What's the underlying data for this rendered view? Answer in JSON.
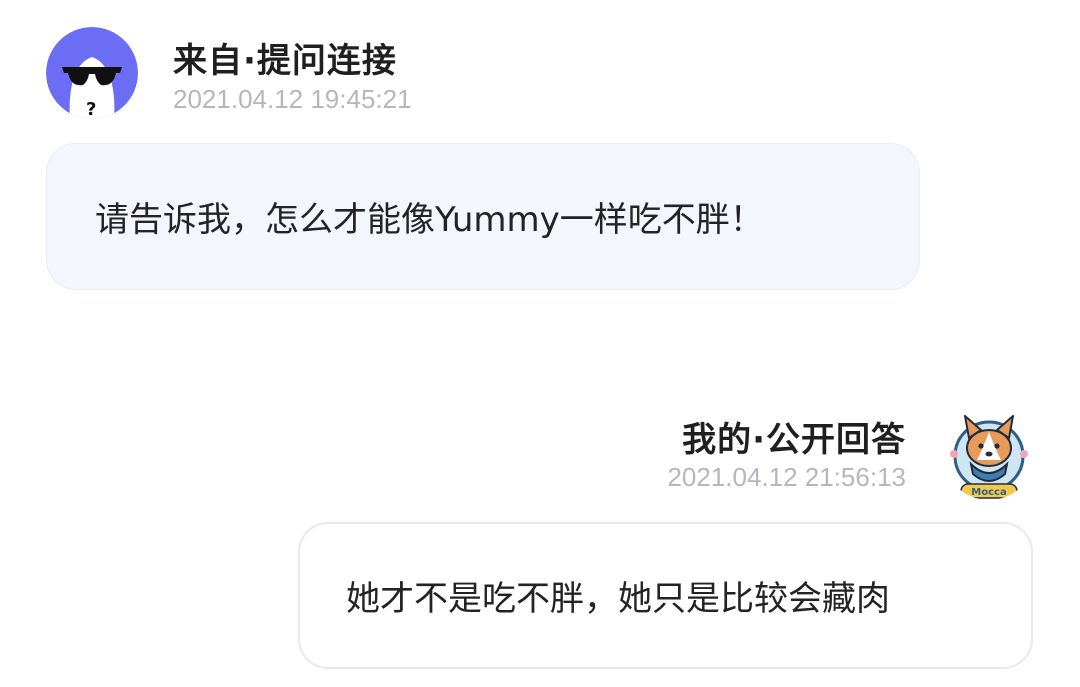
{
  "question": {
    "sender": "来自·提问连接",
    "timestamp": "2021.04.12 19:45:21",
    "message": "请告诉我，怎么才能像Yummy一样吃不胖！",
    "avatar_icon": "sunglasses-ghost-icon",
    "avatar_color": "#6b6df5"
  },
  "answer": {
    "sender": "我的·公开回答",
    "timestamp": "2021.04.12 21:56:13",
    "message": "她才不是吃不胖，她只是比较会藏肉",
    "avatar_icon": "corgi-dog-icon",
    "avatar_badge": "Mocca"
  },
  "colors": {
    "question_bubble_bg": "#f3f6fd",
    "answer_bubble_border": "#e7e9ef",
    "timestamp_text": "#b5b7bd"
  }
}
